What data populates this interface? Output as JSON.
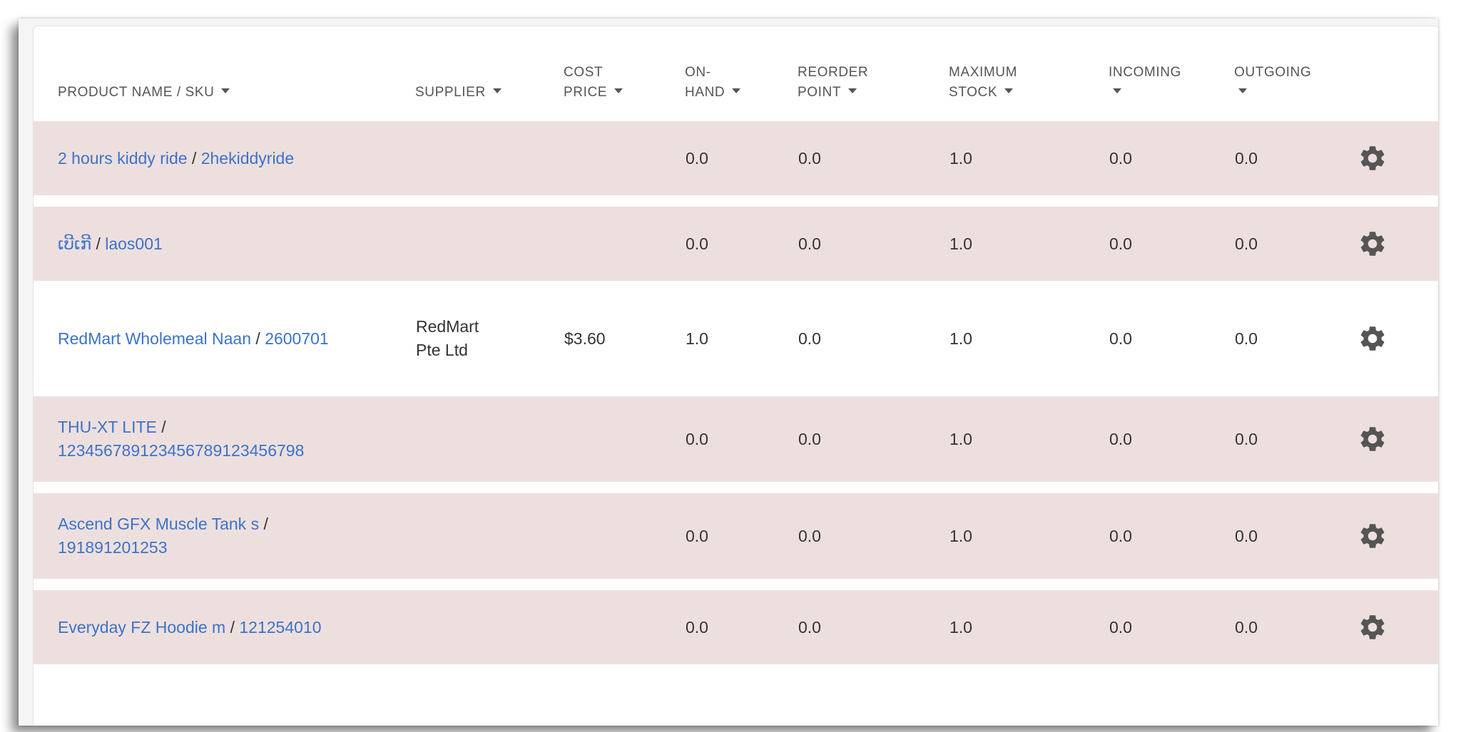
{
  "columns": {
    "product": "PRODUCT NAME / SKU",
    "supplier": "SUPPLIER",
    "cost_price": "COST PRICE",
    "on_hand": "ON- HAND",
    "reorder_point": "REORDER POINT",
    "maximum_stock": "MAXIMUM STOCK",
    "incoming": "INCOMING",
    "outgoing": "OUTGOING"
  },
  "rows": [
    {
      "name": "2 hours kiddy ride",
      "sku": "2hekiddyride",
      "supplier": "",
      "cost_price": "",
      "on_hand": "0.0",
      "reorder_point": "0.0",
      "maximum_stock": "1.0",
      "incoming": "0.0",
      "outgoing": "0.0",
      "highlight": true
    },
    {
      "name": "ເບີເກີ",
      "sku": "laos001",
      "supplier": "",
      "cost_price": "",
      "on_hand": "0.0",
      "reorder_point": "0.0",
      "maximum_stock": "1.0",
      "incoming": "0.0",
      "outgoing": "0.0",
      "highlight": true
    },
    {
      "name": "RedMart Wholemeal Naan",
      "sku": "2600701",
      "supplier": "RedMart Pte Ltd",
      "cost_price": "$3.60",
      "on_hand": "1.0",
      "reorder_point": "0.0",
      "maximum_stock": "1.0",
      "incoming": "0.0",
      "outgoing": "0.0",
      "highlight": false
    },
    {
      "name": "THU-XT LITE",
      "sku": "1234567891234567891234567­98",
      "supplier": "",
      "cost_price": "",
      "on_hand": "0.0",
      "reorder_point": "0.0",
      "maximum_stock": "1.0",
      "incoming": "0.0",
      "outgoing": "0.0",
      "highlight": true
    },
    {
      "name": "Ascend GFX Muscle Tank s",
      "sku": "191891201253",
      "supplier": "",
      "cost_price": "",
      "on_hand": "0.0",
      "reorder_point": "0.0",
      "maximum_stock": "1.0",
      "incoming": "0.0",
      "outgoing": "0.0",
      "highlight": true
    },
    {
      "name": "Everyday FZ Hoodie m",
      "sku": "121254010",
      "supplier": "",
      "cost_price": "",
      "on_hand": "0.0",
      "reorder_point": "0.0",
      "maximum_stock": "1.0",
      "incoming": "0.0",
      "outgoing": "0.0",
      "highlight": true
    }
  ],
  "separator": "/",
  "colors": {
    "row_highlight": "#eedfdf",
    "link": "#3b73c8",
    "header_text": "#555555",
    "gear": "#555555"
  },
  "icons": {
    "row_action": "gear-icon",
    "sort": "caret-down-icon"
  }
}
